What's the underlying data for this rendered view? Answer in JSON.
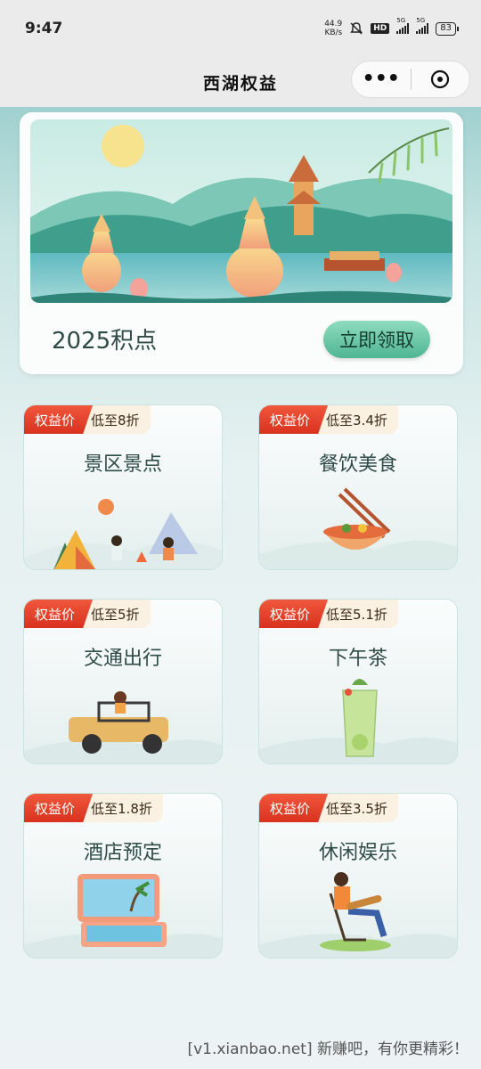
{
  "status_bar": {
    "time": "9:47",
    "net_speed_value": "44.9",
    "net_speed_unit": "KB/s",
    "hd": "HD",
    "net1": "5G",
    "net2": "5G",
    "battery": "83"
  },
  "nav": {
    "title": "西湖权益",
    "more_label": "•••"
  },
  "banner": {
    "points": "2025积点",
    "claim_button": "立即领取"
  },
  "categories": [
    {
      "tag": "权益价",
      "discount": "低至8折",
      "name": "景区景点",
      "icon": "camping-illustration"
    },
    {
      "tag": "权益价",
      "discount": "低至3.4折",
      "name": "餐饮美食",
      "icon": "noodle-bowl-illustration"
    },
    {
      "tag": "权益价",
      "discount": "低至5折",
      "name": "交通出行",
      "icon": "jeep-illustration"
    },
    {
      "tag": "权益价",
      "discount": "低至5.1折",
      "name": "下午茶",
      "icon": "drink-glass-illustration"
    },
    {
      "tag": "权益价",
      "discount": "低至1.8折",
      "name": "酒店预定",
      "icon": "suitcase-illustration"
    },
    {
      "tag": "权益价",
      "discount": "低至3.5折",
      "name": "休闲娱乐",
      "icon": "guitar-chair-illustration"
    }
  ],
  "watermark": "[v1.xianbao.net] 新赚吧，有你更精彩！",
  "colors": {
    "accent_green": "#4fb592",
    "tag_red": "#d9321f",
    "text_dark": "#2f4b45"
  }
}
